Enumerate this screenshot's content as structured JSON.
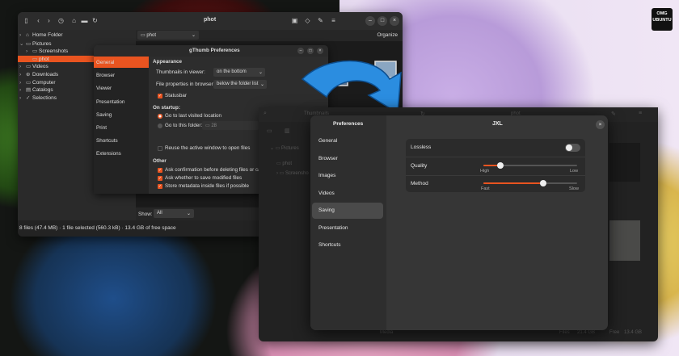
{
  "brand": {
    "logo_text": "OMG UBUNTU"
  },
  "main_window": {
    "title": "phot",
    "path_dropdown": "phot",
    "organize_label": "Organize",
    "tree": [
      {
        "label": "Home Folder",
        "indent": 0,
        "arrow": "›",
        "icon": "⌂",
        "selected": false
      },
      {
        "label": "Pictures",
        "indent": 0,
        "arrow": "⌄",
        "icon": "▭",
        "selected": false
      },
      {
        "label": "Screenshots",
        "indent": 1,
        "arrow": "›",
        "icon": "▭",
        "selected": false
      },
      {
        "label": "phot",
        "indent": 1,
        "arrow": "",
        "icon": "▭",
        "selected": true
      },
      {
        "label": "Videos",
        "indent": 0,
        "arrow": "›",
        "icon": "▭",
        "selected": false
      },
      {
        "label": "Downloads",
        "indent": 0,
        "arrow": "›",
        "icon": "⊕",
        "selected": false
      },
      {
        "label": "Computer",
        "indent": 0,
        "arrow": "›",
        "icon": "▭",
        "selected": false
      },
      {
        "label": "Catalogs",
        "indent": 0,
        "arrow": "›",
        "icon": "▤",
        "selected": false
      },
      {
        "label": "Selections",
        "indent": 0,
        "arrow": "›",
        "icon": "✓",
        "selected": false
      }
    ],
    "show_label": "Show:",
    "show_value": "All",
    "status_text": "8 files (47.4 MB)  ·  1 file selected (560.3 kB)  ·  13.4 GB of free space"
  },
  "prefs_window": {
    "title": "gThumb Preferences",
    "nav": [
      "General",
      "Browser",
      "Viewer",
      "Presentation",
      "Saving",
      "Print",
      "Shortcuts",
      "Extensions"
    ],
    "appearance_heading": "Appearance",
    "thumbs_label": "Thumbnails in viewer:",
    "thumbs_value": "on the bottom",
    "fileprops_label": "File properties in browser:",
    "fileprops_value": "below the folder list",
    "statusbar_label": "Statusbar",
    "startup_heading": "On startup:",
    "goto_last_label": "Go to last visited location",
    "goto_folder_label": "Go to this folder:",
    "goto_folder_value": "28",
    "reuse_label": "Reuse the active window to open files",
    "other_heading": "Other",
    "other_items": [
      "Ask confirmation before deleting files or catal",
      "Ask whether to save modified files",
      "Store metadata inside files if possible"
    ]
  },
  "new_window": {
    "thumbnails_label": "Thumbnails",
    "title": "phot",
    "tree": [
      "Pictures",
      "phot",
      "Screensho"
    ],
    "footer_media": "Media",
    "footer_files": "Files",
    "footer_size": "21.4 GB",
    "footer_free": "Free",
    "footer_free_size": "13.4 GB"
  },
  "jxl_dialog": {
    "sidebar_title": "Preferences",
    "title": "JXL",
    "nav": [
      "General",
      "Browser",
      "Images",
      "Videos",
      "Saving",
      "Presentation",
      "Shortcuts"
    ],
    "active_index": 4,
    "lossless_label": "Lossless",
    "lossless_on": false,
    "quality_label": "Quality",
    "quality_high": "High",
    "quality_low": "Low",
    "quality_level": 0.18,
    "method_label": "Method",
    "method_fast": "Fast",
    "method_slow": "Slow",
    "method_level": 0.64
  },
  "colors": {
    "accent": "#e95420",
    "arrow": "#2b8de0"
  }
}
